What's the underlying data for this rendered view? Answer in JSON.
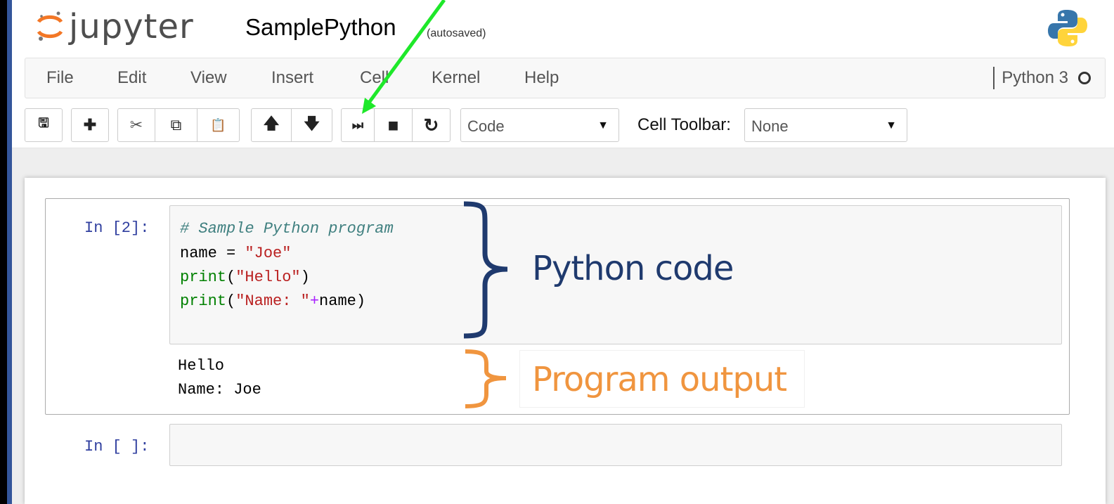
{
  "header": {
    "logo_text": "jupyter",
    "notebook_title": "SamplePython",
    "autosave_status": "(autosaved)"
  },
  "menubar": {
    "items": [
      "File",
      "Edit",
      "View",
      "Insert",
      "Cell",
      "Kernel",
      "Help"
    ],
    "kernel_name": "Python 3"
  },
  "toolbar": {
    "buttons": [
      {
        "icon": "save-icon",
        "glyph": "🖫"
      },
      {
        "icon": "plus-icon",
        "glyph": "✚"
      },
      {
        "icon": "scissors-icon",
        "glyph": "✂"
      },
      {
        "icon": "copy-icon",
        "glyph": "⧉"
      },
      {
        "icon": "paste-icon",
        "glyph": "📋"
      },
      {
        "icon": "arrow-up-icon",
        "glyph": "🡅"
      },
      {
        "icon": "arrow-down-icon",
        "glyph": "🡇"
      },
      {
        "icon": "run-step-icon",
        "glyph": "⏭"
      },
      {
        "icon": "stop-icon",
        "glyph": "■"
      },
      {
        "icon": "restart-icon",
        "glyph": "↻"
      }
    ],
    "cell_type_value": "Code",
    "cell_toolbar_label": "Cell Toolbar:",
    "cell_toolbar_value": "None",
    "caret": "▼"
  },
  "cells": [
    {
      "prompt": "In [2]:",
      "code": [
        "# Sample Python program",
        "name = \"Joe\"",
        "print(\"Hello\")",
        "print(\"Name: \"+name)"
      ],
      "output": [
        "Hello",
        "Name: Joe"
      ]
    },
    {
      "prompt": "In [ ]:",
      "code": [],
      "output": []
    }
  ],
  "annotations": {
    "code_label": "Python code",
    "output_label": "Program output",
    "code_brace_color": "#1f3a6e",
    "output_brace_color": "#f0953f",
    "arrow_color": "#1ee82a"
  }
}
